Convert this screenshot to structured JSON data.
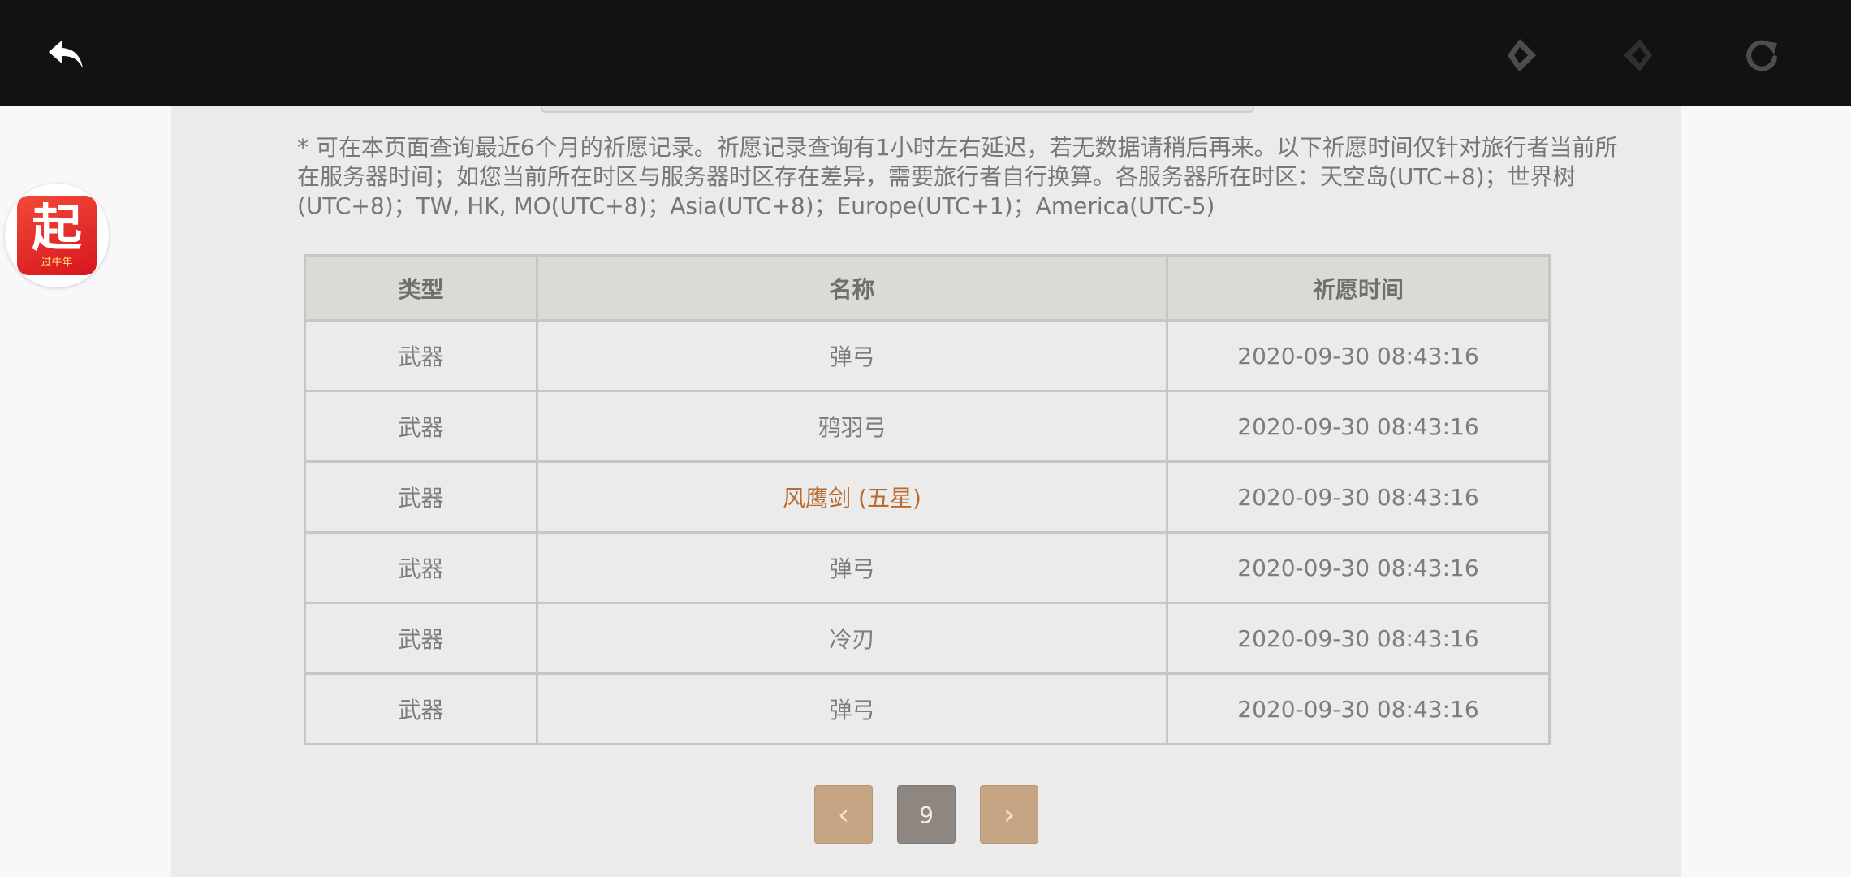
{
  "toolbar": {
    "icons": [
      "back-icon",
      "prev-diamond-icon",
      "next-diamond-icon",
      "refresh-icon"
    ]
  },
  "notice": "* 可在本页面查询最近6个月的祈愿记录。祈愿记录查询有1小时左右延迟，若无数据请稍后再来。以下祈愿时间仅针对旅行者当前所在服务器时间；如您当前所在时区与服务器时区存在差异，需要旅行者自行换算。各服务器所在时区：天空岛(UTC+8)；世界树(UTC+8)；TW, HK, MO(UTC+8)；Asia(UTC+8)；Europe(UTC+1)；America(UTC-5)",
  "table": {
    "headers": [
      "类型",
      "名称",
      "祈愿时间"
    ],
    "rows": [
      {
        "type": "武器",
        "name": "弹弓",
        "time": "2020-09-30 08:43:16"
      },
      {
        "type": "武器",
        "name": "鸦羽弓",
        "time": "2020-09-30 08:43:16"
      },
      {
        "type": "武器",
        "name": "风鹰剑 (五星)",
        "time": "2020-09-30 08:43:16"
      },
      {
        "type": "武器",
        "name": "弹弓",
        "time": "2020-09-30 08:43:16"
      },
      {
        "type": "武器",
        "name": "冷刃",
        "time": "2020-09-30 08:43:16"
      },
      {
        "type": "武器",
        "name": "弹弓",
        "time": "2020-09-30 08:43:16"
      }
    ]
  },
  "pagination": {
    "prev": "‹",
    "current": "9",
    "next": "›"
  },
  "floating_app": {
    "char": "起",
    "subtitle": "过牛年"
  },
  "colors": {
    "five_star": "#b96a2e",
    "pager_arrow": "#c6a584",
    "pager_current": "#8e8781"
  }
}
